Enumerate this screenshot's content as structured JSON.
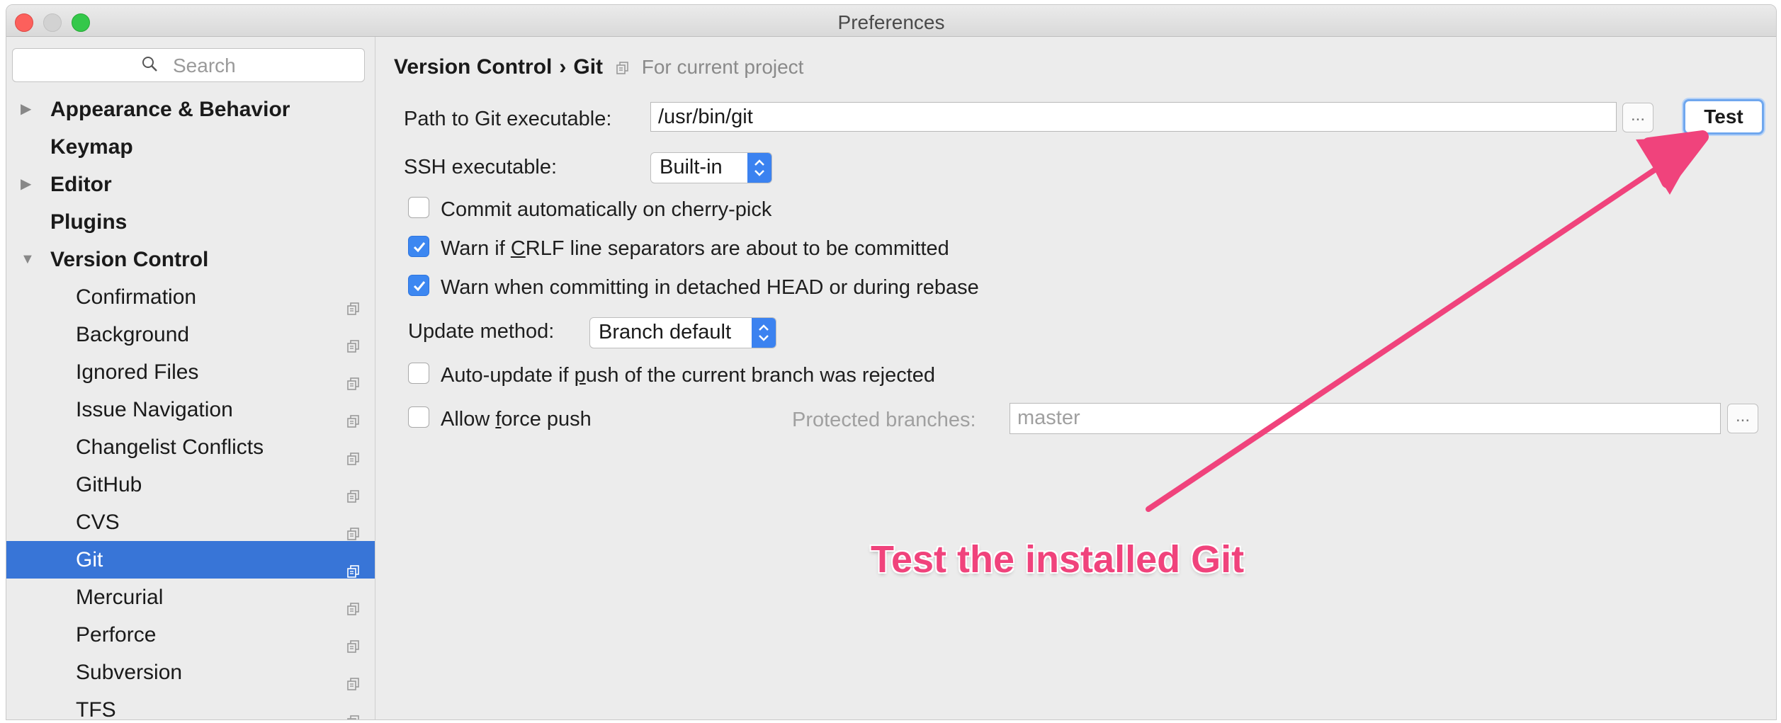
{
  "window": {
    "title": "Preferences"
  },
  "search": {
    "placeholder": "Search"
  },
  "sidebar": {
    "items": [
      {
        "label": "Appearance & Behavior",
        "level": "top",
        "expander": "collapsed"
      },
      {
        "label": "Keymap",
        "level": "top",
        "expander": "none"
      },
      {
        "label": "Editor",
        "level": "top",
        "expander": "collapsed"
      },
      {
        "label": "Plugins",
        "level": "top",
        "expander": "none"
      },
      {
        "label": "Version Control",
        "level": "top",
        "expander": "expanded"
      },
      {
        "label": "Confirmation",
        "level": "sub"
      },
      {
        "label": "Background",
        "level": "sub"
      },
      {
        "label": "Ignored Files",
        "level": "sub"
      },
      {
        "label": "Issue Navigation",
        "level": "sub"
      },
      {
        "label": "Changelist Conflicts",
        "level": "sub"
      },
      {
        "label": "GitHub",
        "level": "sub"
      },
      {
        "label": "CVS",
        "level": "sub"
      },
      {
        "label": "Git",
        "level": "sub",
        "selected": true
      },
      {
        "label": "Mercurial",
        "level": "sub"
      },
      {
        "label": "Perforce",
        "level": "sub"
      },
      {
        "label": "Subversion",
        "level": "sub"
      },
      {
        "label": "TFS",
        "level": "sub"
      }
    ]
  },
  "breadcrumb": {
    "parent": "Version Control",
    "separator": "›",
    "current": "Git",
    "scope_note": "For current project"
  },
  "git": {
    "path_label": "Path to Git executable:",
    "path_value": "/usr/bin/git",
    "browse_label": "...",
    "test_label": "Test",
    "ssh_label": "SSH executable:",
    "ssh_value": "Built-in",
    "cb_cherry_pick": {
      "label": "Commit automatically on cherry-pick",
      "checked": false
    },
    "cb_crlf": {
      "label_pre": "Warn if ",
      "label_u": "C",
      "label_post": "RLF line separators are about to be committed",
      "checked": true
    },
    "cb_detached": {
      "label": "Warn when committing in detached HEAD or during rebase",
      "checked": true
    },
    "update_label": "Update method:",
    "update_value": "Branch default",
    "cb_autoupdate": {
      "label_pre": "Auto-update if ",
      "label_u": "p",
      "label_post": "ush of the current branch was rejected",
      "checked": false
    },
    "cb_force": {
      "label_pre": "Allow ",
      "label_u": "f",
      "label_post": "orce push",
      "checked": false
    },
    "protected_label": "Protected branches:",
    "protected_value": "master",
    "protected_browse": "..."
  },
  "annotation": {
    "text": "Test the installed Git",
    "color": "#f0437c"
  },
  "colors": {
    "selection": "#3875d7",
    "accent": "#3c87f1"
  }
}
